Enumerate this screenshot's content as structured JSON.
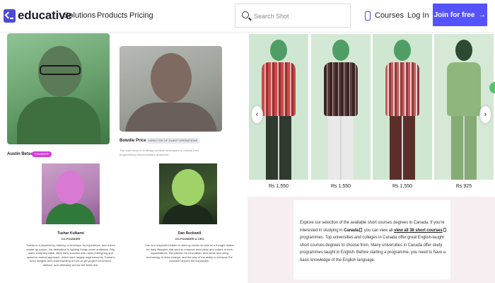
{
  "header": {
    "brand": "educative",
    "nav": [
      "Solutions",
      "Products",
      "Pricing"
    ],
    "search_placeholder": "Search Shot",
    "courses_label": "Courses",
    "login_label": "Log In",
    "join_label": "Join for free",
    "join_arrow": "→"
  },
  "team": {
    "austin": {
      "name": "Austin Betser",
      "role": "FOUNDER"
    },
    "bowdie": {
      "name": "Bowdie Price",
      "role": "DIRECTOR OF GUEST OPERATIONS",
      "bio": "The main focus is to always achieve developers to resolve their programming documentation anywhere."
    }
  },
  "founders": [
    {
      "name": "Tushar Kulkarni",
      "role": "CO-FOUNDER",
      "bio": "Tushar is a physicist by training, a developer by experience, and a born leader by nature. His dedication to fighting things never endlessly. Fifty sales company clash. BB's early success with rapid prototyping and speed-to-market approach, which were largely engineered by Tushar's keen insights and understanding of how to get project concerned, defined, and ultimately across the finish line."
    },
    {
      "name": "Dan Rockwell",
      "role": "CO-FOUNDER & CEO",
      "bio": "Dan is a respected leader in start-up circles as well as a thought leader for daily lifestyles that want to enhance new ideas and culture in their organisations. His passion for innovation, new ideas and using technology to drive change, and the way of the ability to enhance the possible beyond the impossible."
    }
  ],
  "carousel": {
    "prev_icon": "‹",
    "next_icon": "›",
    "products": [
      {
        "price": "Rs 1,550"
      },
      {
        "price": "Rs 1,550"
      },
      {
        "price": "Rs 1,550"
      },
      {
        "price": "Rs 925"
      }
    ]
  },
  "info": {
    "p1": "Explore our selection of the available short courses degrees in Canada. If you're interested in studying in ",
    "country": "Canada",
    "p2": " you can view all ",
    "link": "view all 38 short courses",
    "p3": " programmes. Top universities and colleges in Canada offer great English-taught short courses degrees to choose from. Many universities in Canada offer study programmes taught in English. Before starting a programme, you need to have a basic knowledge of the English language."
  },
  "colors": {
    "brand": "#4b4bd8",
    "join_button": "#5553ff",
    "badge": "#d43bdc",
    "info_panel_bg": "#f7eef2"
  }
}
